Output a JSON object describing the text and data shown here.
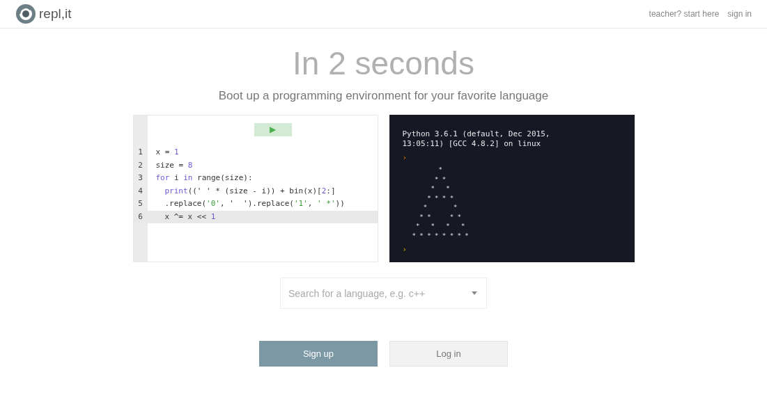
{
  "header": {
    "logo_text": "repl,it",
    "links": [
      "teacher? start here",
      "sign in"
    ]
  },
  "hero": {
    "title": "In 2 seconds",
    "subtitle": "Boot up a programming environment for your favorite language"
  },
  "editor": {
    "run_button": "▶",
    "lines": [
      {
        "number": "1",
        "active": false,
        "indent": false,
        "tokens": [
          {
            "kind": "plain",
            "text": "x = "
          },
          {
            "kind": "number",
            "text": "1"
          }
        ]
      },
      {
        "number": "2",
        "active": false,
        "indent": false,
        "tokens": [
          {
            "kind": "plain",
            "text": "size = "
          },
          {
            "kind": "number",
            "text": "8"
          }
        ]
      },
      {
        "number": "3",
        "active": false,
        "indent": false,
        "tokens": [
          {
            "kind": "keyword",
            "text": "for"
          },
          {
            "kind": "plain",
            "text": " i "
          },
          {
            "kind": "keyword",
            "text": "in"
          },
          {
            "kind": "plain",
            "text": " range(size):"
          }
        ]
      },
      {
        "number": "4",
        "active": false,
        "indent": true,
        "tokens": [
          {
            "kind": "keyword",
            "text": "print"
          },
          {
            "kind": "plain",
            "text": "((' ' * (size - i)) + bin(x)["
          },
          {
            "kind": "number",
            "text": "2"
          },
          {
            "kind": "plain",
            "text": ":]"
          }
        ]
      },
      {
        "number": "5",
        "active": false,
        "indent": true,
        "tokens": [
          {
            "kind": "plain",
            "text": ".replace("
          },
          {
            "kind": "string",
            "text": "'0'"
          },
          {
            "kind": "plain",
            "text": ", '  ').replace("
          },
          {
            "kind": "string",
            "text": "'1'"
          },
          {
            "kind": "plain",
            "text": ", "
          },
          {
            "kind": "string",
            "text": "' *'"
          },
          {
            "kind": "plain",
            "text": "))"
          }
        ]
      },
      {
        "number": "6",
        "active": true,
        "indent": true,
        "tokens": [
          {
            "kind": "plain",
            "text": "x ^= x << "
          },
          {
            "kind": "number",
            "text": "1"
          }
        ]
      }
    ]
  },
  "console": {
    "banner": [
      "Python 3.6.1 (default, Dec 2015,",
      "13:05:11) [GCC 4.8.2] on linux"
    ],
    "prompt": "›",
    "output": "       *\n      * *\n     *   *\n    * * * *\n   *       *\n  * *     * *\n *   *   *   *\n* * * * * * * *"
  },
  "search": {
    "placeholder": "Search for a language, e.g. c++"
  },
  "buttons": [
    {
      "label": "Sign up",
      "kind": "primary"
    },
    {
      "label": "Log in",
      "kind": "secondary"
    }
  ]
}
